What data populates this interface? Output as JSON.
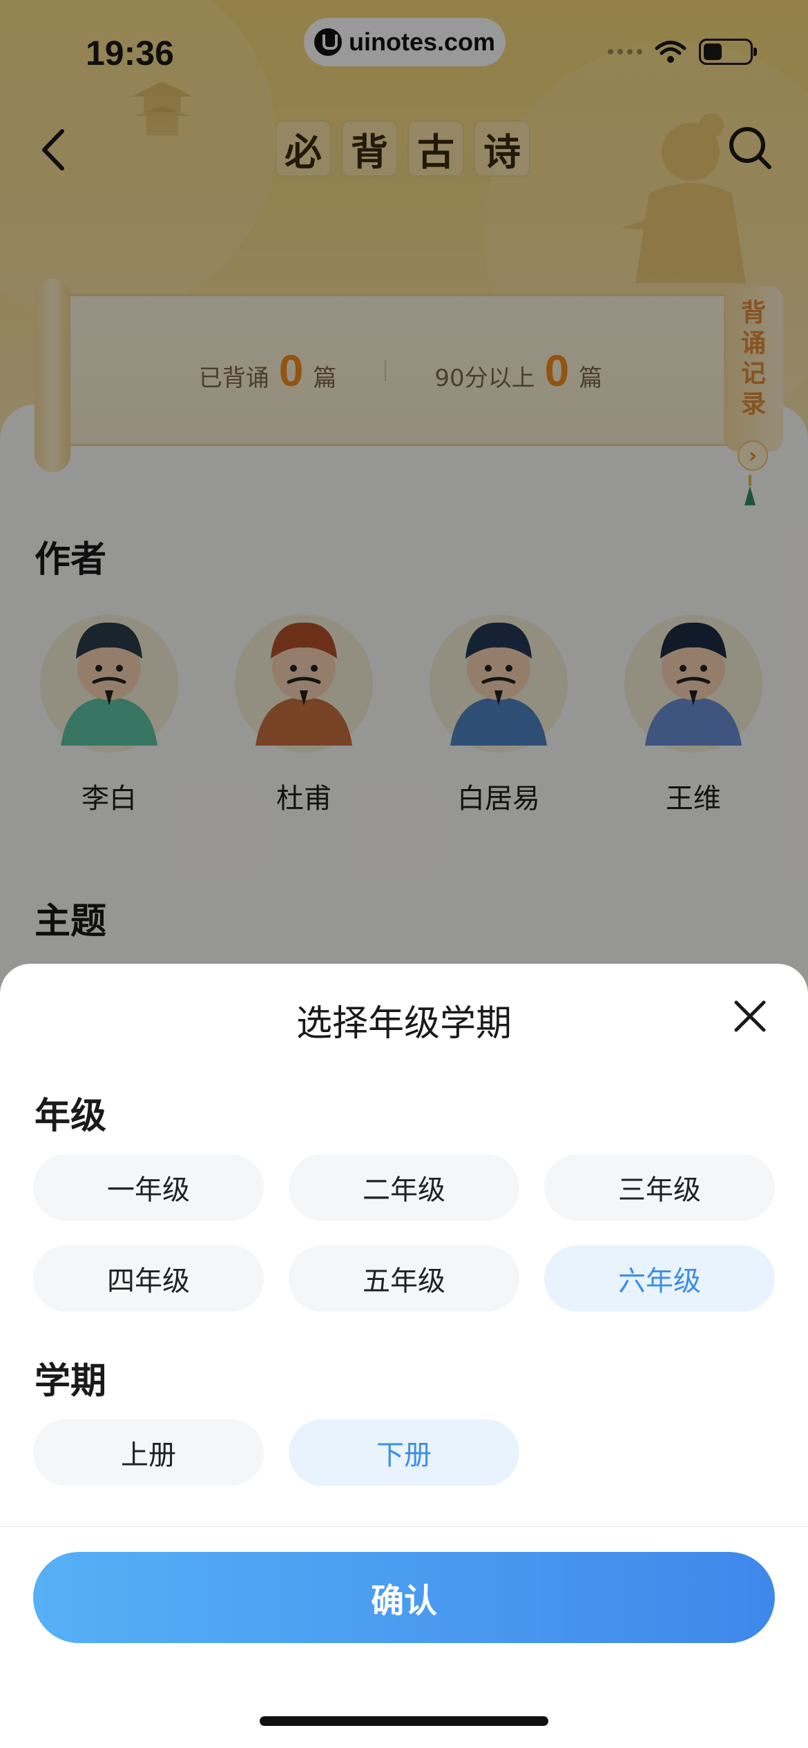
{
  "status_bar": {
    "time": "19:36",
    "url": "uinotes.com",
    "battery_level": 0.4
  },
  "nav": {
    "title_chars": [
      "必",
      "背",
      "古",
      "诗"
    ]
  },
  "stats": {
    "recited_label": "已背诵",
    "recited_count": "0",
    "recited_unit": "篇",
    "high_score_label": "90分以上",
    "high_score_count": "0",
    "high_score_unit": "篇",
    "record_chars": [
      "背",
      "诵",
      "记",
      "录"
    ],
    "record_arrow": "›"
  },
  "authors_section": {
    "title": "作者",
    "items": [
      {
        "name": "李白",
        "robe": "#5fc4a6",
        "hat": "#2a3d4a"
      },
      {
        "name": "杜甫",
        "robe": "#c96e3e",
        "hat": "#b5502a"
      },
      {
        "name": "白居易",
        "robe": "#4f82c4",
        "hat": "#223a55"
      },
      {
        "name": "王维",
        "robe": "#6a8ed4",
        "hat": "#1d2c44"
      }
    ]
  },
  "topics_section": {
    "title": "主题"
  },
  "modal": {
    "title": "选择年级学期",
    "grade_label": "年级",
    "grades": [
      "一年级",
      "二年级",
      "三年级",
      "四年级",
      "五年级",
      "六年级"
    ],
    "selected_grade": "六年级",
    "term_label": "学期",
    "terms": [
      "上册",
      "下册"
    ],
    "selected_term": "下册",
    "confirm_label": "确认"
  },
  "colors": {
    "accent_blue": "#3e8ee6",
    "selected_chip_bg": "#e9f3fd",
    "stat_orange": "#f28c1d",
    "hero_yellow": "#f6d77a"
  }
}
